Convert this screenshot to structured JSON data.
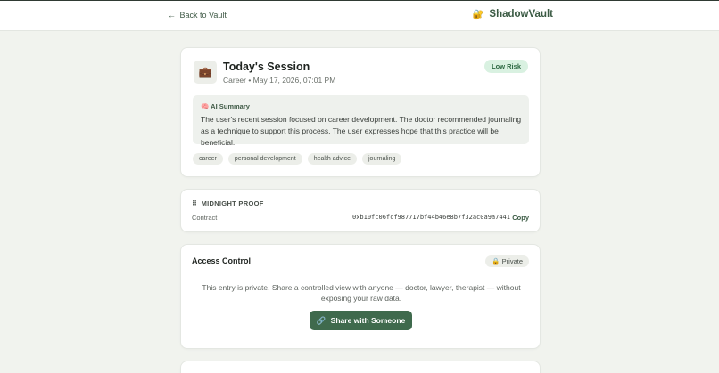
{
  "header": {
    "back_arrow": "←",
    "back_label": "Back to Vault",
    "brand_logo": "🔐",
    "brand_name": "ShadowVault"
  },
  "session": {
    "icon": "💼",
    "title": "Today's Session",
    "meta": "Career • May 17, 2026, 07:01 PM",
    "risk_badge": "Low Risk",
    "summary_icon": "🧠",
    "summary_label": "AI Summary",
    "summary_text": "The user's recent session focused on career development. The doctor recommended journaling as a technique to support this process. The user expresses hope that this practice will be beneficial.",
    "tags": [
      "career",
      "personal development",
      "health advice",
      "journaling"
    ]
  },
  "proof": {
    "icon": "⠿",
    "label": "MIDNIGHT PROOF",
    "contract_label": "Contract",
    "contract_value": "0xb10fc06fcf987717bf44b46e8b7f32ac0a9a7441",
    "copy_label": "Copy"
  },
  "access": {
    "title": "Access Control",
    "badge_icon": "🔒",
    "badge_label": "Private",
    "description": "This entry is private. Share a controlled view with anyone — doctor, lawyer, therapist — without exposing your raw data.",
    "share_icon": "🔗",
    "share_label": "Share with Someone"
  },
  "colors": {
    "accent": "#3f6a4d",
    "background": "#f1f3ee",
    "risk_badge_bg": "#d9f1e1"
  }
}
